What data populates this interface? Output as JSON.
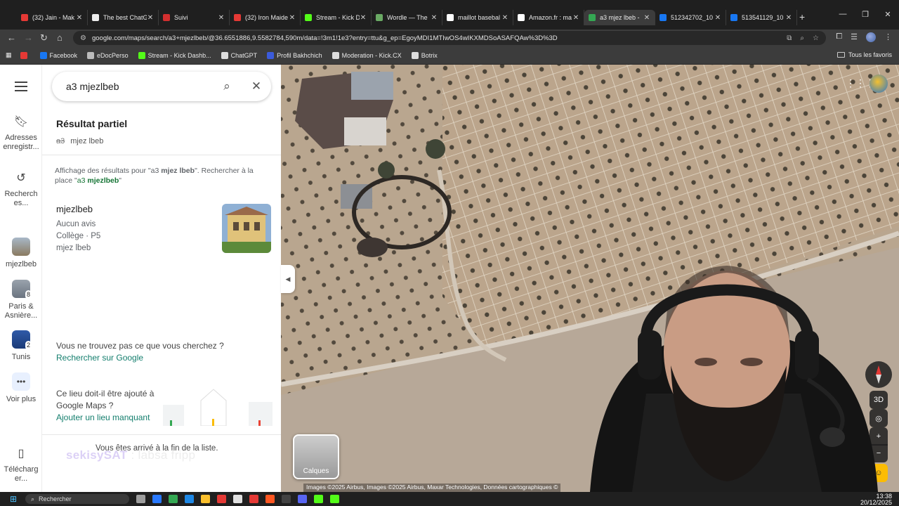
{
  "browser": {
    "tabs": [
      {
        "title": "(32) Jain - Mak",
        "color": "#e53935"
      },
      {
        "title": "The best ChatG",
        "color": "#eeeeee"
      },
      {
        "title": "Suivi",
        "color": "#d32f2f"
      },
      {
        "title": "(32) Iron Maide",
        "color": "#e53935"
      },
      {
        "title": "Stream - Kick D",
        "color": "#53fc18"
      },
      {
        "title": "Wordle — The",
        "color": "#6aaa64"
      },
      {
        "title": "maillot basebal",
        "color": "#ffffff"
      },
      {
        "title": "Amazon.fr : ma",
        "color": "#ffffff"
      },
      {
        "title": "a3 mjez lbeb -",
        "color": "#34a853"
      },
      {
        "title": "512342702_10",
        "color": "#1877f2"
      },
      {
        "title": "513541129_10",
        "color": "#1877f2"
      }
    ],
    "active_tab_index": 8,
    "new_tab": "+",
    "url": "google.com/maps/search/a3+mjezlbeb/@36.6551886,9.5582784,590m/data=!3m1!1e3?entry=ttu&g_ep=EgoyMDI1MTIwOS4wIKXMDSoASAFQAw%3D%3D",
    "bookmarks": [
      {
        "label": "",
        "color": "#e53935"
      },
      {
        "label": "Facebook",
        "color": "#1877f2"
      },
      {
        "label": "eDocPerso",
        "color": "#bbbbbb"
      },
      {
        "label": "Stream - Kick Dashb...",
        "color": "#53fc18"
      },
      {
        "label": "ChatGPT",
        "color": "#dddddd"
      },
      {
        "label": "Profil Bakhchich",
        "color": "#3b5bdb"
      },
      {
        "label": "Moderation - Kick.CX",
        "color": "#dddddd"
      },
      {
        "label": "Botrix",
        "color": "#dddddd"
      }
    ],
    "bookmarks_all": "Tous les favoris"
  },
  "rail": {
    "saved": "Adresses enregistr...",
    "recents": "Recherch es...",
    "recent_places": [
      {
        "label": "mjezlbeb",
        "badge": ""
      },
      {
        "label": "Paris & Asnière...",
        "badge": "8"
      },
      {
        "label": "Tunis",
        "badge": "2"
      }
    ],
    "more": "Voir plus",
    "download": "Télécharg er..."
  },
  "panel": {
    "search_value": "a3 mjezlbeb",
    "section_title": "Résultat partiel",
    "partial_struck": "a3",
    "partial_kept": "mjez lbeb",
    "info_prefix": "Affichage des résultats pour \"a3 ",
    "info_bold": "mjez lbeb",
    "info_mid": "\". Rechercher à la place \"",
    "info_link_a": "a3 ",
    "info_link_b": "mjezlbeb",
    "info_end": "\"",
    "result": {
      "name": "mjezlbeb",
      "reviews": "Aucun avis",
      "category": "Collège · P5",
      "address": "mjez lbeb"
    },
    "notfound_q": "Vous ne trouvez pas ce que vous cherchez ?",
    "notfound_link": "Rechercher sur Google",
    "add_q": "Ce lieu doit-il être ajouté à Google Maps ?",
    "add_link": "Ajouter un lieu manquant",
    "end_text": "Vous êtes arrivé à la fin de la liste.",
    "overlay_name": "sekisySAT",
    "overlay_sub": " : labsa fripp"
  },
  "map": {
    "layers_label": "Calques",
    "copyright": "Images ©2025 Airbus, Images ©2025 Airbus, Maxar Technologies, Données cartographiques ©",
    "btn_3d": "3D",
    "zoom_in": "+",
    "zoom_out": "−"
  },
  "taskbar": {
    "search": "Rechercher",
    "time": "13:38",
    "date": "20/12/2025",
    "icon_colors": [
      "#9e9e9e",
      "#2979ff",
      "#34a853",
      "#1e88e5",
      "#fbc02d",
      "#e53935",
      "#e0e0e0",
      "#e53935",
      "#ff5722",
      "#424242",
      "#5865f2",
      "#53fc18",
      "#53fc18"
    ]
  }
}
